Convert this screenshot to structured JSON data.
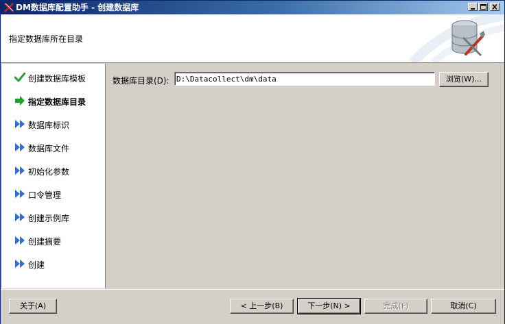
{
  "window": {
    "title": "DM数据库配置助手 - 创建数据库"
  },
  "header": {
    "subtitle": "指定数据库所在目录"
  },
  "steps": [
    {
      "label": "创建数据库模板",
      "state": "done",
      "icon": "check-icon"
    },
    {
      "label": "指定数据库目录",
      "state": "current",
      "icon": "arrow-right-icon"
    },
    {
      "label": "数据库标识",
      "state": "pending",
      "icon": "double-arrow-icon"
    },
    {
      "label": "数据库文件",
      "state": "pending",
      "icon": "double-arrow-icon"
    },
    {
      "label": "初始化参数",
      "state": "pending",
      "icon": "double-arrow-icon"
    },
    {
      "label": "口令管理",
      "state": "pending",
      "icon": "double-arrow-icon"
    },
    {
      "label": "创建示例库",
      "state": "pending",
      "icon": "double-arrow-icon"
    },
    {
      "label": "创建摘要",
      "state": "pending",
      "icon": "double-arrow-icon"
    },
    {
      "label": "创建",
      "state": "pending",
      "icon": "double-arrow-icon"
    }
  ],
  "form": {
    "dir_label": "数据库目录(D):",
    "dir_value": "D:\\Datacollect\\dm\\data",
    "browse_label": "浏览(W)..."
  },
  "footer": {
    "about_label": "关于(A)",
    "prev_label": "< 上一步(B)",
    "next_label": "下一步(N) >",
    "finish_label": "完成(F)",
    "cancel_label": "取消(C)"
  },
  "colors": {
    "title_start": "#0a246a",
    "title_end": "#a6caf0",
    "check": "#2e9e2e",
    "current_arrow": "#22a022",
    "pending_arrow": "#2f6fd0"
  }
}
